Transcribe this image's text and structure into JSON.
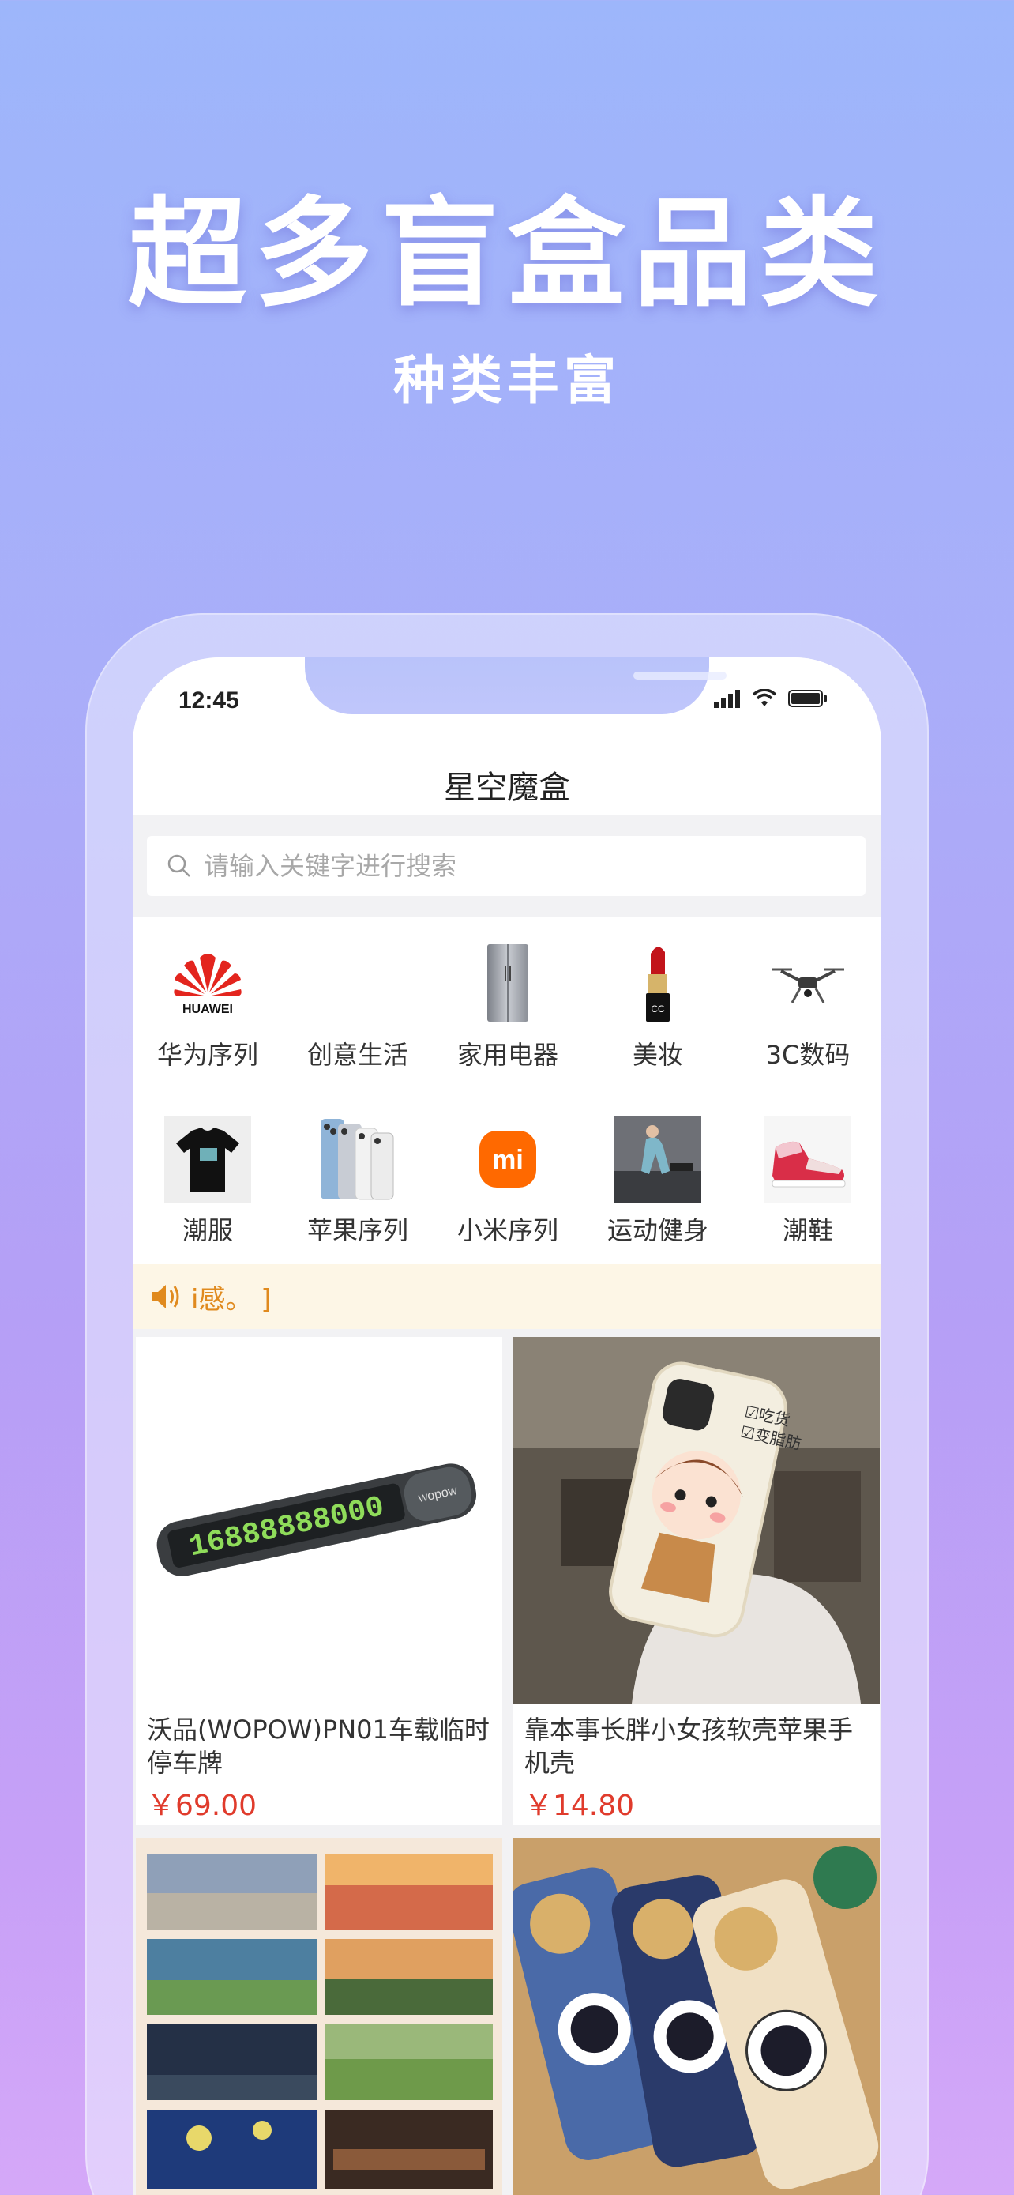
{
  "hero": {
    "title": "超多盲盒品类",
    "subtitle": "种类丰富"
  },
  "status_bar": {
    "time": "12:45"
  },
  "app": {
    "title": "星空魔盒"
  },
  "search": {
    "placeholder": "请输入关键字进行搜索"
  },
  "categories": [
    {
      "label": "华为序列",
      "icon": "huawei-logo-icon",
      "logo_text": "HUAWEI"
    },
    {
      "label": "创意生活",
      "icon": "creative-life-icon"
    },
    {
      "label": "家用电器",
      "icon": "refrigerator-icon"
    },
    {
      "label": "美妆",
      "icon": "lipstick-icon"
    },
    {
      "label": "3C数码",
      "icon": "drone-icon"
    },
    {
      "label": "潮服",
      "icon": "tshirt-icon"
    },
    {
      "label": "苹果序列",
      "icon": "iphone-icon"
    },
    {
      "label": "小米序列",
      "icon": "xiaomi-logo-icon",
      "logo_text": "mi"
    },
    {
      "label": "运动健身",
      "icon": "fitness-icon"
    },
    {
      "label": "潮鞋",
      "icon": "sneaker-icon"
    }
  ],
  "notice": {
    "icon": "speaker-icon",
    "text": "i感。 ]"
  },
  "products": [
    {
      "name": "沃品(WOPOW)PN01车载临时停车牌",
      "price": "￥69.00",
      "image": "parking-number-plate",
      "plate_number": "16888888000",
      "plate_brand": "wopow"
    },
    {
      "name": "靠本事长胖小女孩软壳苹果手机壳",
      "price": "￥14.80",
      "image": "girl-phone-case",
      "case_text_1": "☑吃货",
      "case_text_2": "☑变脂肪"
    },
    {
      "name": "",
      "price": "",
      "image": "painting-collage"
    },
    {
      "name": "",
      "price": "",
      "image": "astronaut-phone-cases"
    }
  ],
  "colors": {
    "accent_price": "#e03b2c",
    "notice_text": "#e08a1e",
    "notice_bg": "#fdf6e6",
    "xiaomi": "#ff6900",
    "huawei": "#e3251e"
  }
}
